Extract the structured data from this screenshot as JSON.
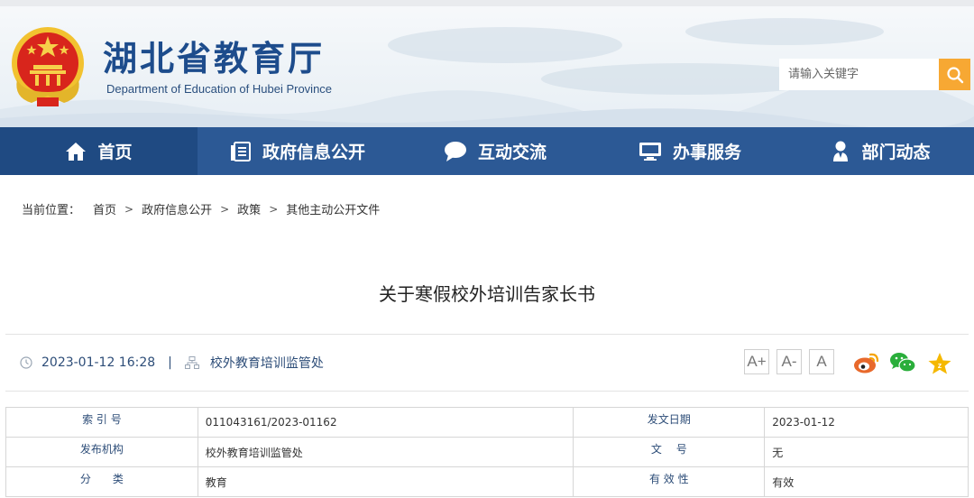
{
  "header": {
    "title": "湖北省教育厅",
    "subtitle": "Department of Education of Hubei Province",
    "emblem_icon": "national-emblem-icon",
    "search": {
      "placeholder": "请输入关键字",
      "button_icon": "search-icon"
    }
  },
  "nav": {
    "items": [
      {
        "label": "首页",
        "icon": "home-icon",
        "active": true
      },
      {
        "label": "政府信息公开",
        "icon": "document-list-icon",
        "active": false
      },
      {
        "label": "互动交流",
        "icon": "chat-bubble-icon",
        "active": false
      },
      {
        "label": "办事服务",
        "icon": "monitor-icon",
        "active": false
      },
      {
        "label": "部门动态",
        "icon": "person-pin-icon",
        "active": false
      }
    ]
  },
  "breadcrumb": {
    "prefix": "当前位置：",
    "items": [
      "首页",
      "政府信息公开",
      "政策",
      "其他主动公开文件"
    ],
    "separator": ">"
  },
  "article": {
    "title": "关于寒假校外培训告家长书",
    "datetime": "2023-01-12 16:28",
    "pipe": "|",
    "source": "校外教育培训监管处",
    "font_sizes": [
      "A+",
      "A-",
      "A"
    ],
    "share_icons": [
      "weibo-icon",
      "wechat-icon",
      "favorite-star-icon"
    ]
  },
  "info_table": {
    "rows": [
      {
        "label1": "索 引 号",
        "value1": "011043161/2023-01162",
        "label2": "发文日期",
        "value2": "2023-01-12"
      },
      {
        "label1": "发布机构",
        "value1": "校外教育培训监管处",
        "label2": "文　 号",
        "value2": "无"
      },
      {
        "label1": "分　　类",
        "value1": "教育",
        "label2": "有 效 性",
        "value2": "有效"
      }
    ]
  },
  "colors": {
    "nav_bg": "#2c5995",
    "nav_active": "#1f4a82",
    "title_blue": "#1d4c8c",
    "search_button": "#f7a833",
    "weibo_orange": "#e8692b",
    "wechat_green": "#2aae3b",
    "star_gold": "#f5b800"
  }
}
